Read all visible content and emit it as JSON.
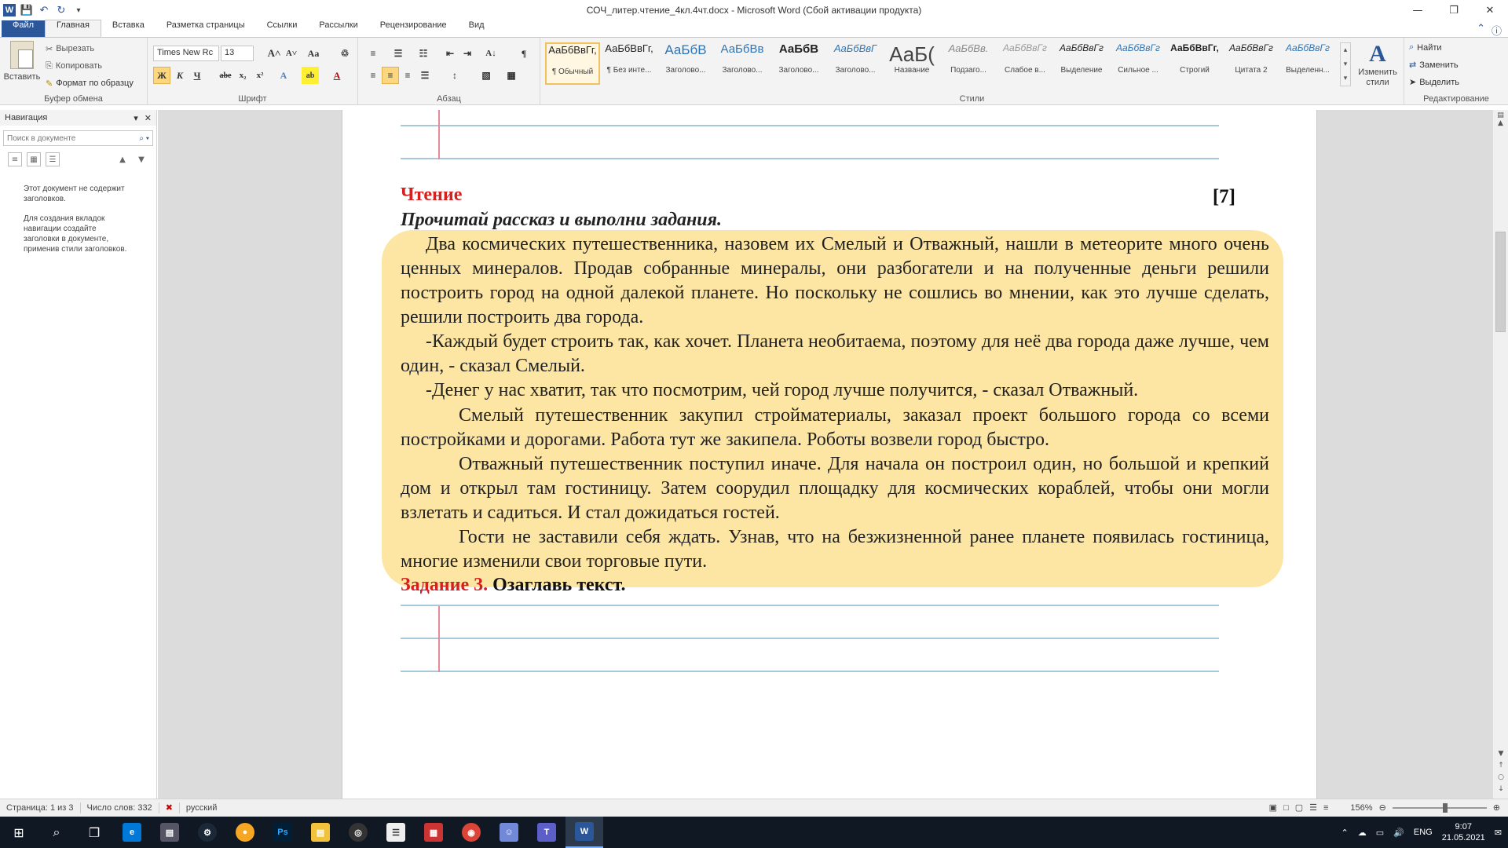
{
  "window": {
    "title": "СОЧ_литер.чтение_4кл.4чт.docx - Microsoft Word (Сбой активации продукта)",
    "qat": [
      "word-logo",
      "save-icon",
      "undo-icon",
      "redo-icon"
    ]
  },
  "tabs": [
    "Файл",
    "Главная",
    "Вставка",
    "Разметка страницы",
    "Ссылки",
    "Рассылки",
    "Рецензирование",
    "Вид"
  ],
  "ribbon": {
    "clipboard": {
      "paste": "Вставить",
      "cut": "Вырезать",
      "copy": "Копировать",
      "format_painter": "Формат по образцу",
      "label": "Буфер обмена"
    },
    "font": {
      "family": "Times New Rc",
      "size": "13",
      "label": "Шрифт"
    },
    "paragraph": {
      "label": "Абзац"
    },
    "styles": {
      "label": "Стили",
      "items": [
        {
          "sample": "АаБбВвГг,",
          "name": "¶ Обычный"
        },
        {
          "sample": "АаБбВвГг,",
          "name": "¶ Без инте..."
        },
        {
          "sample": "АаБбВ",
          "name": "Заголово..."
        },
        {
          "sample": "АаБбВв",
          "name": "Заголово..."
        },
        {
          "sample": "АаБбВ",
          "name": "Заголово..."
        },
        {
          "sample": "АаБбВвГ",
          "name": "Заголово..."
        },
        {
          "sample": "АаБ(",
          "name": "Название"
        },
        {
          "sample": "АаБбВв.",
          "name": "Подзаго..."
        },
        {
          "sample": "АаБбВвГг",
          "name": "Слабое в..."
        },
        {
          "sample": "АаБбВвГг",
          "name": "Выделение"
        },
        {
          "sample": "АаБбВвГг",
          "name": "Сильное ..."
        },
        {
          "sample": "АаБбВвГг,",
          "name": "Строгий"
        },
        {
          "sample": "АаБбВвГг",
          "name": "Цитата 2"
        },
        {
          "sample": "АаБбВвГг",
          "name": "Выделенн..."
        }
      ],
      "change": "Изменить стили"
    },
    "editing": {
      "find": "Найти",
      "replace": "Заменить",
      "select": "Выделить",
      "label": "Редактирование"
    }
  },
  "nav": {
    "title": "Навигация",
    "search_placeholder": "Поиск в документе",
    "msg1": "Этот документ не содержит заголовков.",
    "msg2": "Для создания вкладок навигации создайте заголовки в документе, применив стили заголовков."
  },
  "doc": {
    "heading": "Чтение",
    "score": "[7]",
    "instruction": "Прочитай рассказ и выполни задания.",
    "p1": "Два космических путешественника, назовем их Смелый и Отважный, нашли в метеорите много очень ценных минералов. Продав собранные минералы, они разбогатели и на полученные деньги решили построить город на одной далекой планете. Но поскольку не сошлись во мнении, как это лучше сделать, решили построить два города.",
    "p2": "-Каждый будет строить так, как хочет. Планета необитаема, поэтому для неё два города даже лучше, чем один, - сказал Смелый.",
    "p3": "-Денег у нас хватит, так что посмотрим, чей город лучше получится, - сказал Отважный.",
    "p4": "Смелый путешественник закупил стройматериалы, заказал проект большого города со всеми постройками и дорогами. Работа тут же закипела. Роботы возвели город быстро.",
    "p5": "Отважный путешественник поступил иначе. Для начала он построил один, но большой и крепкий дом и открыл там гостиницу. Затем соорудил площадку для космических кораблей, чтобы они могли взлетать и садиться. И стал дожидаться гостей.",
    "p6": "Гости не заставили себя ждать. Узнав, что на безжизненной ранее планете появилась гостиница, многие изменили свои торговые пути.",
    "task_label": "Задание 3.",
    "task_text": "Озаглавь текст."
  },
  "status": {
    "page": "Страница: 1 из 3",
    "words": "Число слов: 332",
    "lang": "русский",
    "zoom": "156%"
  },
  "taskbar": {
    "lang": "ENG",
    "time": "9:07",
    "date": "21.05.2021"
  }
}
